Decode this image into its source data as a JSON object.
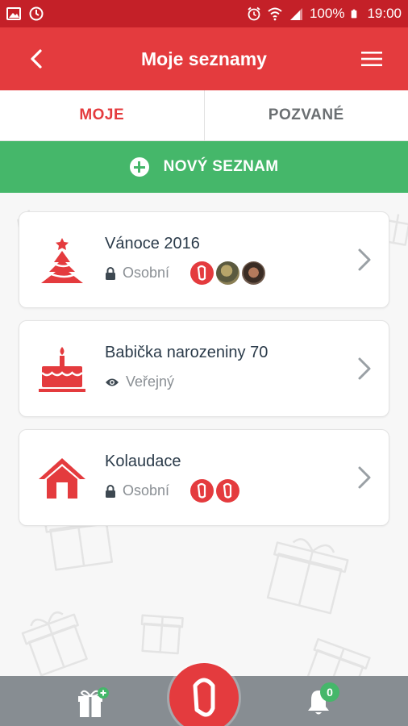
{
  "status_bar": {
    "battery_percent": "100%",
    "time": "19:00",
    "left_icons": [
      "gallery-icon",
      "alarm-clock-icon"
    ],
    "right_icons": [
      "alarm-icon",
      "wifi-icon",
      "signal-icon",
      "battery-icon"
    ]
  },
  "toolbar": {
    "title": "Moje seznamy",
    "back_icon": "back-arrow-icon",
    "menu_icon": "hamburger-menu-icon"
  },
  "tabs": [
    {
      "label": "MOJE",
      "active": true
    },
    {
      "label": "POZVANÉ",
      "active": false
    }
  ],
  "new_list": {
    "label": "NOVÝ SEZNAM",
    "icon": "plus-circle-icon"
  },
  "lists": [
    {
      "name": "Vánoce 2016",
      "visibility": "Osobní",
      "visibility_icon": "lock-icon",
      "icon": "christmas-tree-icon",
      "members": [
        "brand-avatar",
        "photo-avatar",
        "photo-avatar"
      ]
    },
    {
      "name": "Babička narozeniny 70",
      "visibility": "Veřejný",
      "visibility_icon": "eye-icon",
      "icon": "birthday-cake-icon",
      "members": []
    },
    {
      "name": "Kolaudace",
      "visibility": "Osobní",
      "visibility_icon": "lock-icon",
      "icon": "house-icon",
      "members": [
        "brand-avatar",
        "brand-avatar"
      ]
    }
  ],
  "bottom_bar": {
    "left_icon": "gift-add-icon",
    "center_icon": "brand-logo-icon",
    "right_icon": "bell-icon",
    "notification_count": "0"
  },
  "colors": {
    "primary_red": "#e43b3e",
    "status_red": "#c42028",
    "green": "#45b76a",
    "bottom_gray": "#878d92"
  }
}
